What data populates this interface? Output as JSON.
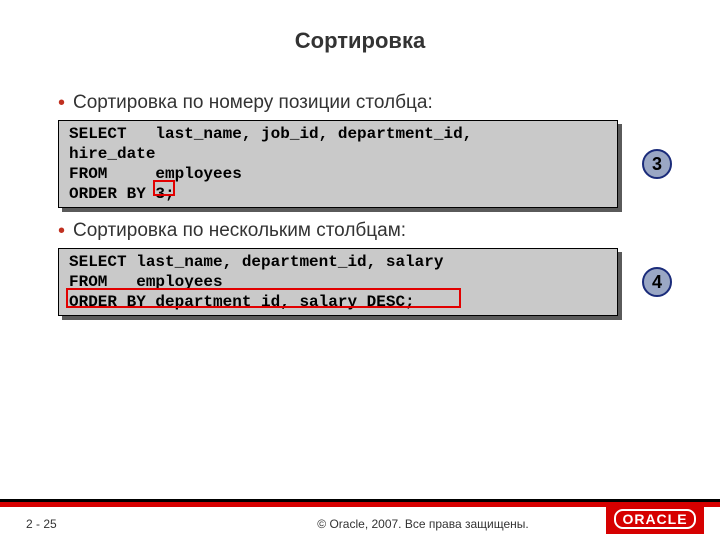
{
  "title": "Сортировка",
  "bullets": {
    "b1": "Сортировка по номеру позиции столбца:",
    "b2": "Сортировка по нескольким столбцам:"
  },
  "code": {
    "c1": "SELECT   last_name, job_id, department_id,\nhire_date\nFROM     employees\nORDER BY 3;",
    "c2": "SELECT last_name, department_id, salary\nFROM   employees\nORDER BY department_id, salary DESC;"
  },
  "badges": {
    "n1": "3",
    "n2": "4"
  },
  "footer": {
    "page": "2 - 25",
    "copyright": "© Oracle, 2007. Все права защищены.",
    "logo": "ORACLE"
  }
}
